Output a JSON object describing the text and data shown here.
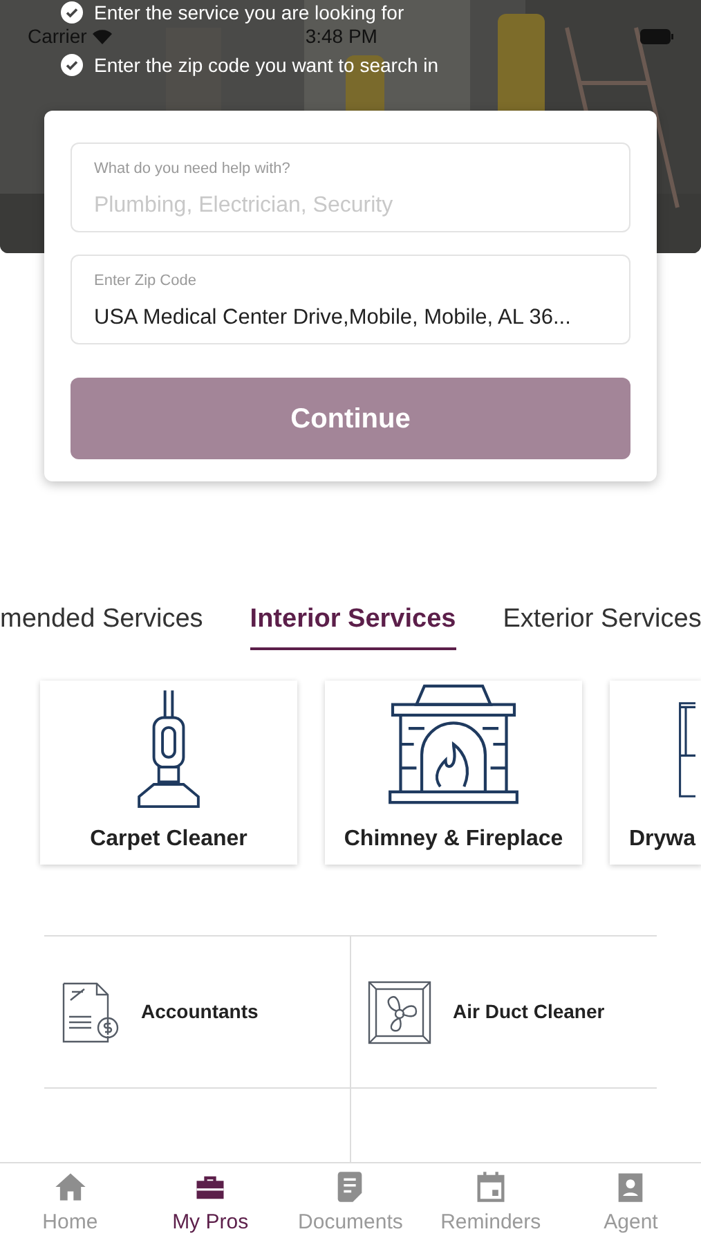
{
  "status_bar": {
    "carrier": "Carrier",
    "time": "3:48 PM"
  },
  "hero": {
    "kind": "picture",
    "steps": [
      "Enter the service you are looking for",
      "Enter the zip code you want to search in"
    ]
  },
  "search_card": {
    "service_field": {
      "label": "What do you need help with?",
      "placeholder": "Plumbing, Electrician, Security"
    },
    "zip_field": {
      "label": "Enter Zip Code",
      "value": "USA Medical Center Drive,Mobile, Mobile, AL 36..."
    },
    "button": "Continue"
  },
  "tabs": [
    {
      "label": "mended Services",
      "selected": false
    },
    {
      "label": "Interior Services",
      "selected": true
    },
    {
      "label": "Exterior Services",
      "selected": false
    }
  ],
  "featured": [
    {
      "name": "Carpet Cleaner",
      "kind": "vacuum"
    },
    {
      "name": "Chimney & Fireplace",
      "kind": "fireplace"
    },
    {
      "name": "Drywa",
      "kind": "drywall"
    }
  ],
  "services": [
    {
      "name": "Accountants",
      "kind": "accountant"
    },
    {
      "name": "Air Duct Cleaner",
      "kind": "vent"
    }
  ],
  "nav": [
    {
      "label": "Home",
      "kind": "home",
      "selected": false
    },
    {
      "label": "My Pros",
      "kind": "toolbox",
      "selected": true
    },
    {
      "label": "Documents",
      "kind": "document",
      "selected": false
    },
    {
      "label": "Reminders",
      "kind": "calendar",
      "selected": false
    },
    {
      "label": "Agent",
      "kind": "badge",
      "selected": false
    }
  ]
}
